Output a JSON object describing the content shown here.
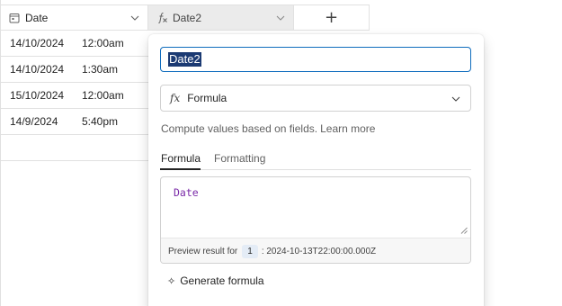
{
  "columns": {
    "date": {
      "label": "Date",
      "icon": "calendar-icon"
    },
    "date2": {
      "label": "Date2",
      "icon": "formula-icon"
    },
    "add": {
      "label": "+"
    }
  },
  "rows": [
    {
      "date": "14/10/2024",
      "time": "12:00am"
    },
    {
      "date": "14/10/2024",
      "time": "1:30am"
    },
    {
      "date": "15/10/2024",
      "time": "12:00am"
    },
    {
      "date": "14/9/2024",
      "time": "5:40pm"
    }
  ],
  "editor": {
    "field_name": "Date2",
    "type_label": "Formula",
    "type_icon": "fx",
    "description": "Compute values based on fields.",
    "learn_more": "Learn more",
    "tabs": [
      "Formula",
      "Formatting"
    ],
    "formula": "Date",
    "preview": {
      "label": "Preview result for",
      "row": "1",
      "value": ": 2024-10-13T22:00:00.000Z"
    },
    "generate_label": "Generate formula",
    "generate_icon": "✧"
  },
  "colors": {
    "accent": "#0f6cbd",
    "selection": "#1b3a73",
    "formula_text": "#7a2aa8"
  }
}
